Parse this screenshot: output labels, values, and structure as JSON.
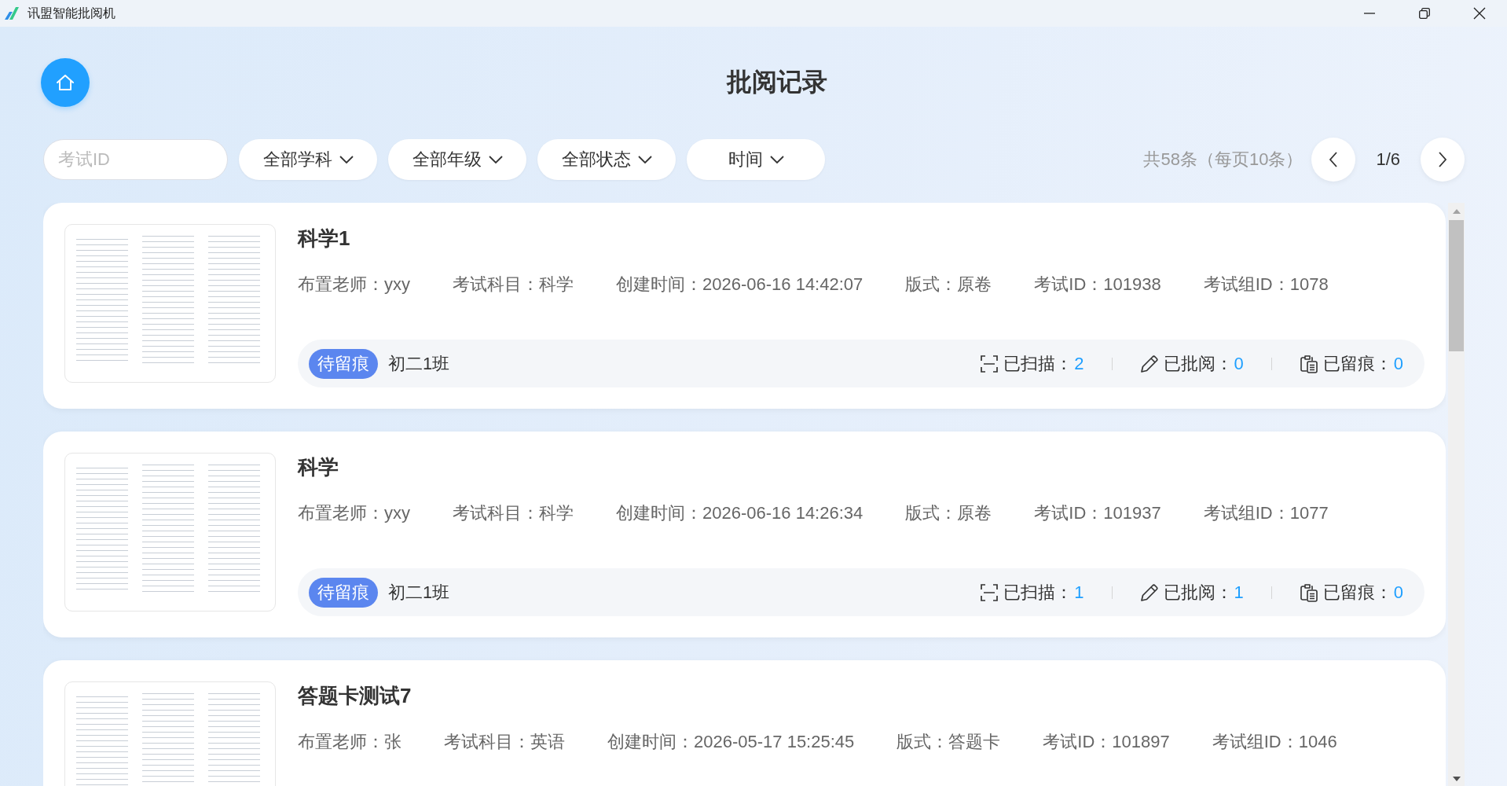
{
  "window": {
    "title": "讯盟智能批阅机"
  },
  "header": {
    "title": "批阅记录"
  },
  "filters": {
    "search": {
      "placeholder": "考试ID"
    },
    "dropdowns": [
      {
        "label": "全部学科"
      },
      {
        "label": "全部年级"
      },
      {
        "label": "全部状态"
      },
      {
        "label": "时间"
      }
    ]
  },
  "pagination": {
    "summary": "共58条（每页10条）",
    "page": "1/6"
  },
  "records": [
    {
      "title": "科学1",
      "meta": [
        "布置老师：yxy",
        "考试科目：科学",
        "创建时间：2026-06-16 14:42:07",
        "版式：原卷",
        "考试ID：101938",
        "考试组ID：1078"
      ],
      "status": "待留痕",
      "class_name": "初二1班",
      "stats": [
        {
          "kind": "scanned",
          "label": "已扫描：",
          "value": "2"
        },
        {
          "kind": "reviewed",
          "label": "已批阅：",
          "value": "0"
        },
        {
          "kind": "marked",
          "label": "已留痕：",
          "value": "0"
        }
      ]
    },
    {
      "title": "科学",
      "meta": [
        "布置老师：yxy",
        "考试科目：科学",
        "创建时间：2026-06-16 14:26:34",
        "版式：原卷",
        "考试ID：101937",
        "考试组ID：1077"
      ],
      "status": "待留痕",
      "class_name": "初二1班",
      "stats": [
        {
          "kind": "scanned",
          "label": "已扫描：",
          "value": "1"
        },
        {
          "kind": "reviewed",
          "label": "已批阅：",
          "value": "1"
        },
        {
          "kind": "marked",
          "label": "已留痕：",
          "value": "0"
        }
      ]
    },
    {
      "title": "答题卡测试7",
      "meta": [
        "布置老师：张",
        "考试科目：英语",
        "创建时间：2026-05-17 15:25:45",
        "版式：答题卡",
        "考试ID：101897",
        "考试组ID：1046"
      ]
    }
  ]
}
